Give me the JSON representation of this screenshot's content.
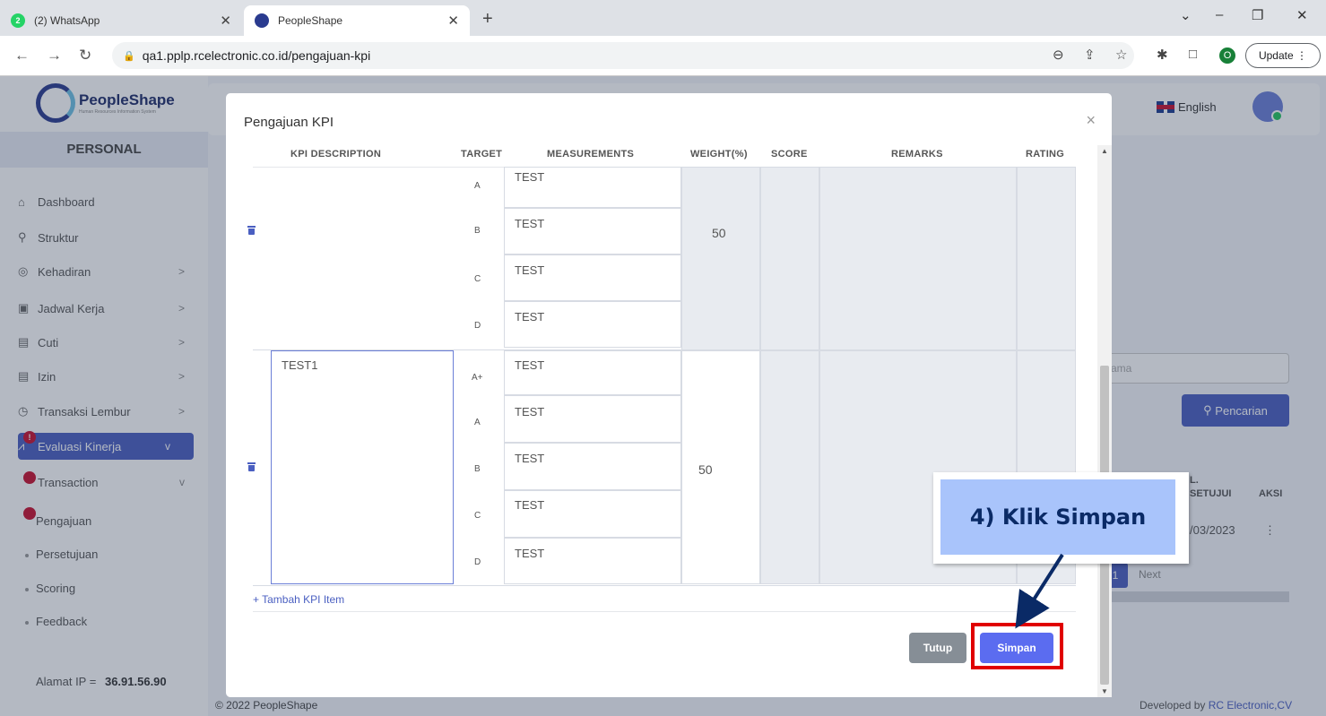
{
  "browser": {
    "tabs": [
      {
        "title": "(2) WhatsApp",
        "badge": "2"
      },
      {
        "title": "PeopleShape"
      }
    ],
    "url": "qa1.pplp.rcelectronic.co.id/pengajuan-kpi",
    "profile_initial": "O",
    "update_label": "Update"
  },
  "app": {
    "logo_name": "PeopleShape",
    "logo_tagline": "Human Resources Information System",
    "section": "PERSONAL",
    "menu": [
      {
        "label": "Dashboard",
        "icon": "home-icon"
      },
      {
        "label": "Struktur",
        "icon": "org-chart-icon"
      },
      {
        "label": "Kehadiran",
        "icon": "fingerprint-icon",
        "chevron": ">"
      },
      {
        "label": "Jadwal Kerja",
        "icon": "briefcase-icon",
        "chevron": ">"
      },
      {
        "label": "Cuti",
        "icon": "calendar-icon",
        "chevron": ">"
      },
      {
        "label": "Izin",
        "icon": "calendar-icon",
        "chevron": ">"
      },
      {
        "label": "Transaksi Lembur",
        "icon": "clock-icon",
        "chevron": ">"
      },
      {
        "label": "Evaluasi Kinerja",
        "icon": "chart-icon",
        "chevron": "v",
        "alert": "!"
      },
      {
        "label": "Transaction",
        "icon": "alert-icon",
        "chevron": "v"
      }
    ],
    "submenu": [
      "Pengajuan",
      "Persetujuan",
      "Scoring",
      "Feedback"
    ],
    "ip_label": "Alamat IP",
    "ip_sep": "=",
    "ip_value": "36.91.56.90",
    "language": "English",
    "bg_search_placeholder": "ama",
    "bg_search_button": "Pencarian",
    "bg_table_headers": [
      "L.",
      "SETUJUI",
      "AKSI"
    ],
    "bg_table_date": "/03/2023",
    "bg_row_action": "⋮",
    "bg_page": "1",
    "bg_next": "Next",
    "footer_left": "© 2022 PeopleShape",
    "footer_right_prefix": "Developed by ",
    "footer_right_link": "RC Electronic,CV"
  },
  "modal": {
    "title": "Pengajuan KPI",
    "close": "×",
    "columns": [
      "KPI DESCRIPTION",
      "TARGET",
      "MEASUREMENTS",
      "WEIGHT(%)",
      "SCORE",
      "REMARKS",
      "RATING"
    ],
    "items": [
      {
        "description": "",
        "weight": "50",
        "targets": [
          {
            "target": "A",
            "measurement": "TEST"
          },
          {
            "target": "B",
            "measurement": "TEST"
          },
          {
            "target": "C",
            "measurement": "TEST"
          },
          {
            "target": "D",
            "measurement": "TEST"
          }
        ]
      },
      {
        "description": "TEST1",
        "weight": "50",
        "targets": [
          {
            "target": "A+",
            "measurement": "TEST"
          },
          {
            "target": "A",
            "measurement": "TEST"
          },
          {
            "target": "B",
            "measurement": "TEST"
          },
          {
            "target": "C",
            "measurement": "TEST"
          },
          {
            "target": "D",
            "measurement": "TEST"
          }
        ]
      }
    ],
    "add_item_label": "+ Tambah KPI Item",
    "close_button": "Tutup",
    "save_button": "Simpan"
  },
  "annotation": {
    "callout_text": "4) Klik Simpan",
    "highlight_color": "#e00000",
    "callout_bg": "#a9c4fb"
  }
}
